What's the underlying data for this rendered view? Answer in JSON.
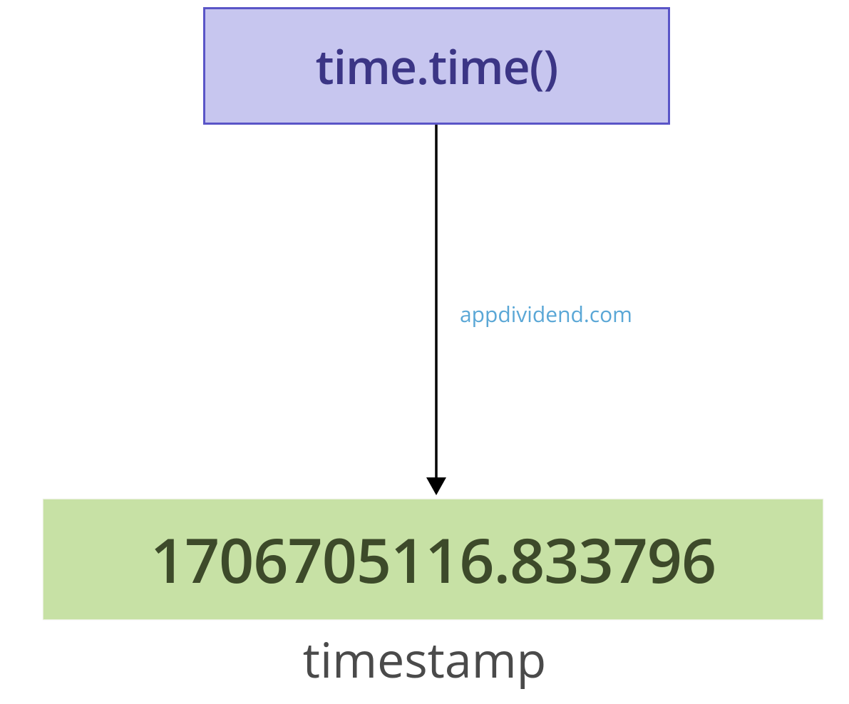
{
  "top_box": {
    "label": "time.time()"
  },
  "watermark": {
    "text": "appdividend.com"
  },
  "bottom_box": {
    "value": "1706705116.833796"
  },
  "caption": {
    "text": "timestamp"
  },
  "arrow": {
    "from": "time.time()",
    "to": "timestamp"
  }
}
